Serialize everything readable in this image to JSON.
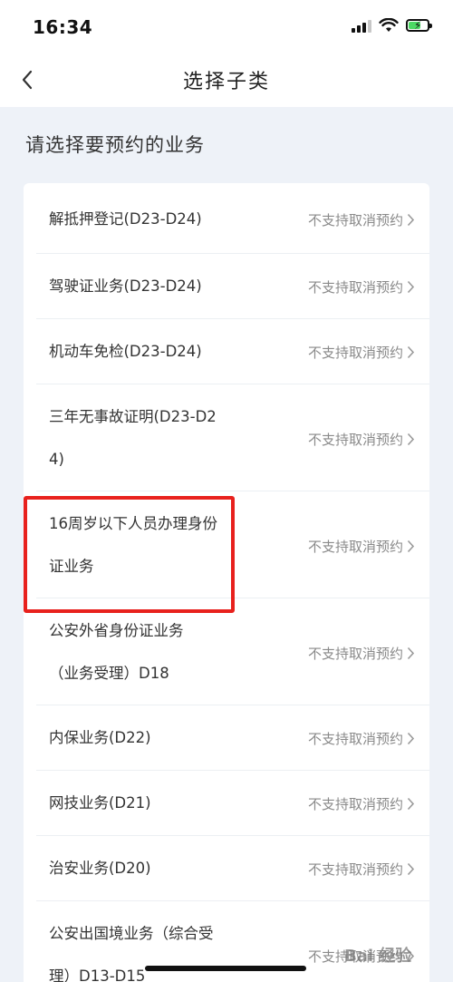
{
  "status_bar": {
    "time": "16:34"
  },
  "nav": {
    "title": "选择子类"
  },
  "section_title": "请选择要预约的业务",
  "services": [
    {
      "name": "解抵押登记(D23-D24)",
      "status": "不支持取消预约"
    },
    {
      "name": "驾驶证业务(D23-D24)",
      "status": "不支持取消预约"
    },
    {
      "name": "机动车免检(D23-D24)",
      "status": "不支持取消预约"
    },
    {
      "name": "三年无事故证明(D23-D24)",
      "status": "不支持取消预约"
    },
    {
      "name": "16周岁以下人员办理身份证业务",
      "status": "不支持取消预约"
    },
    {
      "name": "公安外省身份证业务（业务受理）D18",
      "status": "不支持取消预约"
    },
    {
      "name": "内保业务(D22)",
      "status": "不支持取消预约"
    },
    {
      "name": "网技业务(D21)",
      "status": "不支持取消预约"
    },
    {
      "name": "治安业务(D20)",
      "status": "不支持取消预约"
    },
    {
      "name": "公安出国境业务（综合受理）D13-D15",
      "status": "不支持取消预约"
    }
  ],
  "watermark_text": "Bai 经验",
  "colors": {
    "background": "#eef2f8",
    "highlight": "#e8211d",
    "status_text": "#8a8a8a"
  }
}
